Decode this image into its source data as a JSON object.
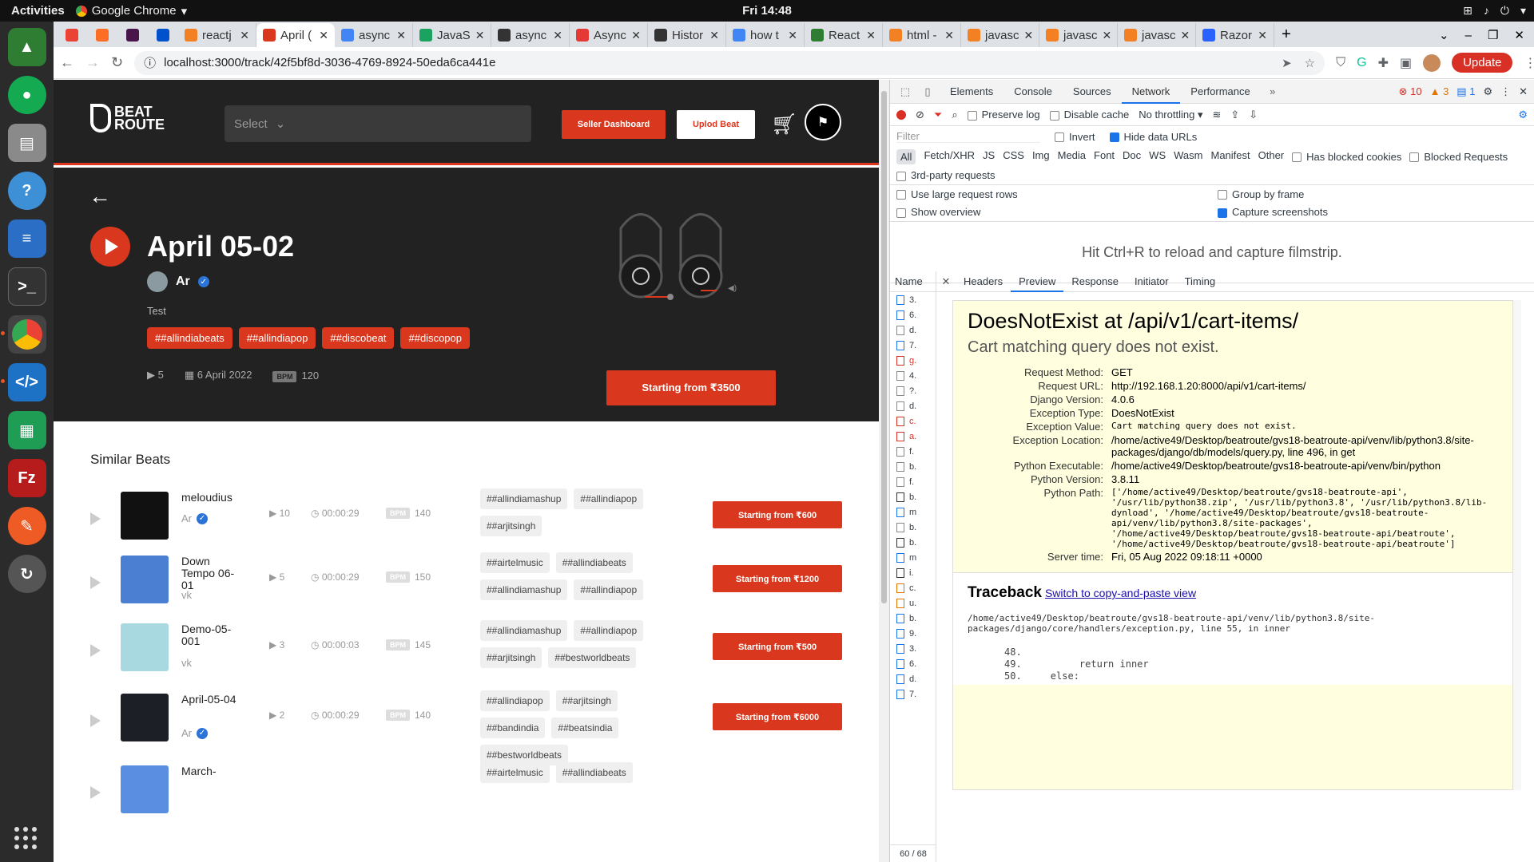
{
  "topbar": {
    "activities": "Activities",
    "app": "Google Chrome",
    "clock": "Fri 14:48"
  },
  "dock": [
    "rocket",
    "mongodb",
    "files",
    "help",
    "writer",
    "terminal",
    "chrome",
    "vscode",
    "calc",
    "filezilla",
    "postman",
    "updater"
  ],
  "browser": {
    "tabs": [
      {
        "label": "",
        "pinned": true,
        "color": "#ea4335"
      },
      {
        "label": "",
        "pinned": true,
        "color": "#fc6d26"
      },
      {
        "label": "",
        "pinned": true,
        "color": "#4a154b"
      },
      {
        "label": "",
        "pinned": true,
        "color": "#0052cc"
      },
      {
        "label": "reactj",
        "color": "#f48024"
      },
      {
        "label": "April (",
        "active": true,
        "color": "#d9381e"
      },
      {
        "label": "async",
        "color": "#4285f4"
      },
      {
        "label": "JavaS",
        "color": "#1aa260"
      },
      {
        "label": "async",
        "color": "#333"
      },
      {
        "label": "Async",
        "color": "#e53935"
      },
      {
        "label": "Histor",
        "color": "#333"
      },
      {
        "label": "how t",
        "color": "#4285f4"
      },
      {
        "label": "React",
        "color": "#2e7d32"
      },
      {
        "label": "html -",
        "color": "#f48024"
      },
      {
        "label": "javasc",
        "color": "#f48024"
      },
      {
        "label": "javasc",
        "color": "#f48024"
      },
      {
        "label": "javasc",
        "color": "#f48024"
      },
      {
        "label": "Razor",
        "color": "#2962ff"
      }
    ],
    "url": "localhost:3000/track/42f5bf8d-3036-4769-8924-50eda6ca441e",
    "update_label": "Update"
  },
  "site": {
    "logo_top": "BEAT",
    "logo_bottom": "ROUTE",
    "select_placeholder": "Select",
    "seller_dashboard": "Seller Dashboard",
    "upload_beat": "Uplod Beat",
    "track": {
      "title": "April 05-02",
      "artist": "Ar",
      "description": "Test",
      "tags": [
        "##allindiabeats",
        "##allindiapop",
        "##discobeat",
        "##discopop"
      ],
      "plays": "5",
      "date": "6 April 2022",
      "bpm_label": "BPM",
      "bpm": "120",
      "price_button": "Starting from ₹3500"
    },
    "similar_title": "Similar Beats",
    "similar": [
      {
        "name": "meloudius",
        "artist": "Ar",
        "verified": true,
        "plays": "10",
        "duration": "00:00:29",
        "bpm": "140",
        "tags": [
          "##allindiamashup",
          "##allindiapop",
          "##arjitsingh"
        ],
        "price": "Starting from ₹600",
        "thumb": "#111"
      },
      {
        "name": "Down Tempo 06-01",
        "artist": "vk",
        "verified": false,
        "plays": "5",
        "duration": "00:00:29",
        "bpm": "150",
        "tags": [
          "##airtelmusic",
          "##allindiabeats",
          "##allindiamashup",
          "##allindiapop"
        ],
        "price": "Starting from ₹1200",
        "thumb": "#4a7fd1"
      },
      {
        "name": "Demo-05-001",
        "artist": "vk",
        "verified": false,
        "plays": "3",
        "duration": "00:00:03",
        "bpm": "145",
        "tags": [
          "##allindiamashup",
          "##allindiapop",
          "##arjitsingh",
          "##bestworldbeats"
        ],
        "price": "Starting from ₹500",
        "thumb": "#a8d8e0"
      },
      {
        "name": "April-05-04",
        "artist": "Ar",
        "verified": true,
        "plays": "2",
        "duration": "00:00:29",
        "bpm": "140",
        "tags": [
          "##allindiapop",
          "##arjitsingh",
          "##bandindia",
          "##beatsindia",
          "##bestworldbeats"
        ],
        "price": "Starting from ₹6000",
        "thumb": "#1c2026"
      },
      {
        "name": "March-",
        "artist": "",
        "verified": false,
        "plays": "",
        "duration": "",
        "bpm": "",
        "tags": [
          "##airtelmusic",
          "##allindiabeats"
        ],
        "price": "",
        "thumb": "#5a8ee0"
      }
    ]
  },
  "devtools": {
    "tabs": [
      "Elements",
      "Console",
      "Sources",
      "Network",
      "Performance"
    ],
    "errors": "10",
    "warnings": "3",
    "messages": "1",
    "toolbar": {
      "preserve_log": "Preserve log",
      "disable_cache": "Disable cache",
      "throttling": "No throttling"
    },
    "filter_placeholder": "Filter",
    "invert": "Invert",
    "hide_data_urls": "Hide data URLs",
    "types": [
      "All",
      "Fetch/XHR",
      "JS",
      "CSS",
      "Img",
      "Media",
      "Font",
      "Doc",
      "WS",
      "Wasm",
      "Manifest",
      "Other"
    ],
    "has_blocked_cookies": "Has blocked cookies",
    "blocked_requests": "Blocked Requests",
    "third_party": "3rd-party requests",
    "large_rows": "Use large request rows",
    "group_by_frame": "Group by frame",
    "show_overview": "Show overview",
    "capture_screenshots": "Capture screenshots",
    "filmstrip_hint": "Hit Ctrl+R to reload and capture filmstrip.",
    "name_header": "Name",
    "requests": [
      "3.",
      "6.",
      "d.",
      "7.",
      "g.",
      "4.",
      "?.",
      "d.",
      "c.",
      "a.",
      "f.",
      "b.",
      "f.",
      "b.",
      "m",
      "b.",
      "b.",
      "m",
      "i.",
      "c.",
      "u.",
      "b.",
      "9.",
      "3.",
      "6.",
      "d.",
      "7."
    ],
    "status": "60 / 68",
    "detail_tabs": [
      "Headers",
      "Preview",
      "Response",
      "Initiator",
      "Timing"
    ],
    "preview": {
      "title": "DoesNotExist at /api/v1/cart-items/",
      "subtitle": "Cart matching query does not exist.",
      "rows": [
        {
          "k": "Request Method:",
          "v": "GET"
        },
        {
          "k": "Request URL:",
          "v": "http://192.168.1.20:8000/api/v1/cart-items/"
        },
        {
          "k": "Django Version:",
          "v": "4.0.6"
        },
        {
          "k": "Exception Type:",
          "v": "DoesNotExist"
        },
        {
          "k": "Exception Value:",
          "v": "Cart matching query does not exist.",
          "mono": true
        },
        {
          "k": "Exception Location:",
          "v": "/home/active49/Desktop/beatroute/gvs18-beatroute-api/venv/lib/python3.8/site-packages/django/db/models/query.py, line 496, in get"
        },
        {
          "k": "Python Executable:",
          "v": "/home/active49/Desktop/beatroute/gvs18-beatroute-api/venv/bin/python"
        },
        {
          "k": "Python Version:",
          "v": "3.8.11"
        },
        {
          "k": "Python Path:",
          "v": "['/home/active49/Desktop/beatroute/gvs18-beatroute-api', '/usr/lib/python38.zip', '/usr/lib/python3.8', '/usr/lib/python3.8/lib-dynload', '/home/active49/Desktop/beatroute/gvs18-beatroute-api/venv/lib/python3.8/site-packages', '/home/active49/Desktop/beatroute/gvs18-beatroute-api/beatroute', '/home/active49/Desktop/beatroute/gvs18-beatroute-api/beatroute']",
          "mono": true
        },
        {
          "k": "Server time:",
          "v": "Fri, 05 Aug 2022 09:18:11 +0000"
        }
      ],
      "traceback": "Traceback",
      "traceback_link": "Switch to copy-and-paste view",
      "trace_file": "/home/active49/Desktop/beatroute/gvs18-beatroute-api/venv/lib/python3.8/site-packages/django/core/handlers/exception.py, line 55, in inner",
      "code": "48.\n49.          return inner\n50.     else:"
    }
  }
}
